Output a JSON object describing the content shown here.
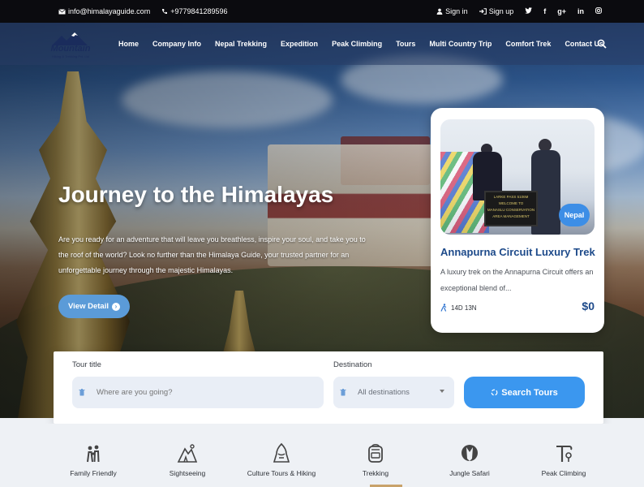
{
  "topbar": {
    "email": "info@himalayaguide.com",
    "phone": "+9779841289596",
    "sign_in": "Sign in",
    "sign_up": "Sign up",
    "social": [
      "f",
      "g+",
      "in"
    ]
  },
  "logo": {
    "name": "Mountain",
    "tagline": "Hiking & Trekking Pvt. Ltd"
  },
  "nav": {
    "items": [
      "Home",
      "Company Info",
      "Nepal Trekking",
      "Expedition",
      "Peak Climbing",
      "Tours",
      "Multi Country Trip",
      "Comfort Trek",
      "Contact Us"
    ]
  },
  "hero": {
    "title": "Journey to the Himalayas",
    "description": "Are you ready for an adventure that will leave you breathless, inspire your soul, and take you to the roof of the world? Look no further than the Himalaya Guide, your trusted partner for an unforgettable journey through the majestic Himalayas.",
    "button": "View Detail"
  },
  "card": {
    "badge": "Nepal",
    "sign_text": [
      "LARKE PASS 5106M",
      "WELCOME TO",
      "MANASLU CONSERVATION",
      "AREA MANAGEMENT"
    ],
    "title": "Annapurna Circuit Luxury Trek",
    "description": "A luxury trek on the Annapurna Circuit offers an exceptional blend of...",
    "duration": "14D 13N",
    "price": "$0"
  },
  "search": {
    "tour_label": "Tour title",
    "tour_placeholder": "Where are you going?",
    "destination_label": "Destination",
    "destination_value": "All destinations",
    "button": "Search Tours"
  },
  "categories": [
    {
      "label": "Family Friendly",
      "icon": "family-icon"
    },
    {
      "label": "Sightseeing",
      "icon": "sightseeing-icon"
    },
    {
      "label": "Culture Tours & Hiking",
      "icon": "culture-icon"
    },
    {
      "label": "Trekking",
      "icon": "backpack-icon"
    },
    {
      "label": "Jungle Safari",
      "icon": "safari-icon"
    },
    {
      "label": "Peak Climbing",
      "icon": "ice-axe-icon"
    }
  ],
  "colors": {
    "primary": "#3b97ef",
    "title_blue": "#1d4a8a",
    "topbar": "#0b0b0f"
  }
}
